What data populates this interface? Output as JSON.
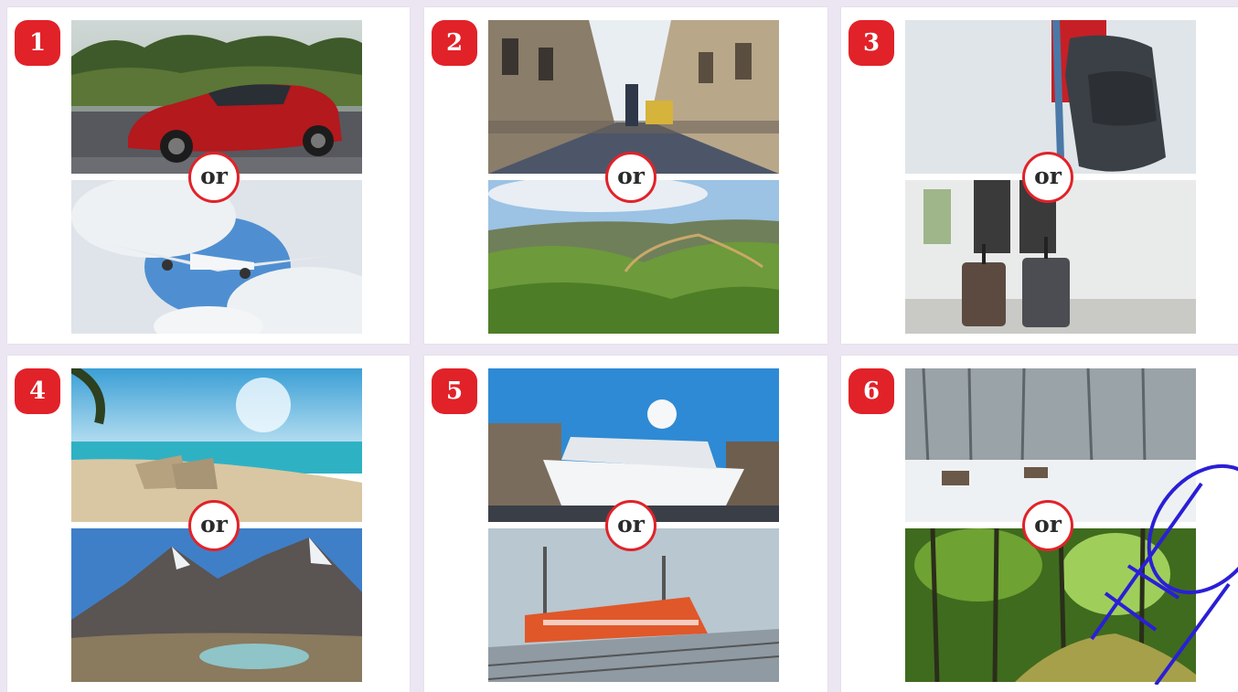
{
  "cards": [
    {
      "number": "1",
      "or": "or",
      "top_photo": "red sports car on road",
      "bottom_photo": "airplane in clouds"
    },
    {
      "number": "2",
      "or": "or",
      "top_photo": "busy city street",
      "bottom_photo": "green countryside hills"
    },
    {
      "number": "3",
      "or": "or",
      "top_photo": "person with backpack",
      "bottom_photo": "travellers with suitcases"
    },
    {
      "number": "4",
      "or": "or",
      "top_photo": "beach with deck chairs",
      "bottom_photo": "snowy mountains and lake"
    },
    {
      "number": "5",
      "or": "or",
      "top_photo": "cruise ship in port",
      "bottom_photo": "red train at station"
    },
    {
      "number": "6",
      "or": "or",
      "top_photo": "snowy park with benches",
      "bottom_photo": "green forest path"
    }
  ],
  "colors": {
    "accent": "#e12229",
    "background": "#ece6f3",
    "watermark": "#2a1fd6"
  }
}
